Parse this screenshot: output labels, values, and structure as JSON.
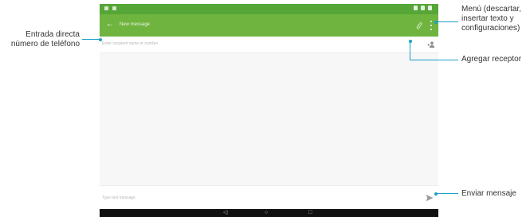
{
  "toolbar": {
    "title": "New message"
  },
  "recipient": {
    "placeholder": "Enter recipient name or number"
  },
  "compose": {
    "placeholder": "Type text message"
  },
  "callouts": {
    "direct_entry": [
      "Entrada directa",
      "número de teléfono"
    ],
    "menu": [
      "Menú (descartar,",
      "insertar texto y",
      "configuraciones)"
    ],
    "add_recipient": "Agregar receptor",
    "send": "Enviar mensaje"
  },
  "colors": {
    "statusbar": "#56a637",
    "toolbar": "#6fb43f",
    "callout_line": "#1aa0c9"
  },
  "icons": {
    "back": "arrow-left-icon",
    "attach": "paperclip-icon",
    "menu": "overflow-menu-icon",
    "add_recipient": "add-person-icon",
    "send": "send-icon"
  }
}
